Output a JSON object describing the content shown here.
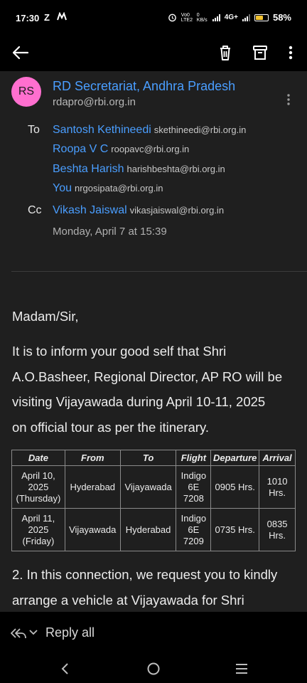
{
  "status_bar": {
    "time": "17:30",
    "notif_icons": [
      "Z",
      "M"
    ],
    "network_label": "Vo0 LTE2",
    "speed_label": "0 KB/s",
    "network_type": "4G+",
    "battery_percent": "58%",
    "battery_level": 0.58
  },
  "app_bar": {
    "icons": [
      "back-arrow-icon",
      "delete-icon",
      "archive-icon",
      "more-vert-icon"
    ]
  },
  "email": {
    "avatar_initials": "RS",
    "avatar_color": "#ff6fcf",
    "sender_name": "RD Secretariat, Andhra Pradesh",
    "sender_email": "rdapro@rbi.org.in",
    "to_label": "To",
    "cc_label": "Cc",
    "to": [
      {
        "name": "Santosh Kethineedi",
        "email": "skethineedi@rbi.org.in"
      },
      {
        "name": "Roopa V C",
        "email": "roopavc@rbi.org.in"
      },
      {
        "name": "Beshta Harish",
        "email": "harishbeshta@rbi.org.in"
      },
      {
        "name": "You",
        "email": "nrgosipata@rbi.org.in"
      }
    ],
    "cc": [
      {
        "name": "Vikash Jaiswal",
        "email": "vikasjaiswal@rbi.org.in"
      }
    ],
    "date": "Monday, April 7 at 15:39",
    "greeting": "Madam/Sir,",
    "para1_lines": [
      "It is to inform your good self that Shri",
      "A.O.Basheer, Regional Director, AP RO will be",
      "visiting Vijayawada during April 10-11, 2025",
      "on official tour as per the itinerary."
    ],
    "table": {
      "headers": [
        "Date",
        "From",
        "To",
        "Flight",
        "Departure",
        "Arrival"
      ],
      "rows": [
        [
          "April 10, 2025 (Thursday)",
          "Hyderabad",
          "Vijayawada",
          "Indigo 6E 7208",
          "0905 Hrs.",
          "1010 Hrs."
        ],
        [
          "April 11, 2025 (Friday)",
          "Vijayawada",
          "Hyderabad",
          "Indigo 6E 7209",
          "0735 Hrs.",
          "0835 Hrs."
        ]
      ]
    },
    "para2_lines": [
      "2. In this connection, we request you to kindly",
      "arrange a vehicle at Vijayawada for Shri"
    ]
  },
  "reply_bar": {
    "label": "Reply all"
  },
  "colors": {
    "link_blue": "#4a9eff",
    "content_bg": "#1f1f1f",
    "battery_yellow": "#f2c230"
  }
}
